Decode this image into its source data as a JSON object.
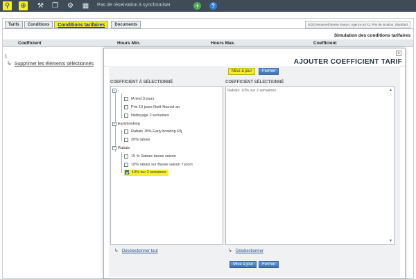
{
  "toolbar": {
    "icons": [
      "search-icon",
      "add-icon",
      "tools-icon",
      "copy-icon",
      "settings-icon",
      "calendar-icon"
    ],
    "status": "Pas de réservation à synchroniser",
    "green_button": "+",
    "help_button": "?"
  },
  "page": {
    "tabs": [
      "Tarifs",
      "Conditions",
      "Conditions tarifaires",
      "Documents"
    ],
    "tenant_info": "2022 [temporel] Basse Saison, Agence aXYZ, Prix de location, Standard",
    "simulation_title": "Simulation des conditions tarifaires",
    "table_headers": {
      "coefficient": "Coefficient",
      "hours_min": "Hours Min.",
      "hours_max": "Hours Max.",
      "coefficient2": "Coefficient"
    },
    "row_number": "1",
    "delete_selected": "Supprimer les éléments sélectionnés"
  },
  "modal": {
    "close": "x",
    "title": "AJOUTER COEFFICIENT TARIF",
    "update_label": "Mise à jour",
    "close_label": "Fermer",
    "dot": ".",
    "left_header": "COEFFICIENT À SÉLECTIONNÉ",
    "right_header": "COEFFICIENT SÉLECTIONNÉ",
    "tree": {
      "root": "-",
      "root_items": [
        "IA test 3 jours",
        "Prix 10 jours Noël-Nouvel-an",
        "Nettoyage 2 semaines"
      ],
      "group_earlybooking": "Earlybooking",
      "earlybooking_items": [
        "Rabais 15% Early booking 60j",
        "20% rabais"
      ],
      "group_rabais": "Rabais",
      "rabais_items": [
        "15 % Rabais basse saison",
        "10% rabais sur Basse saison 7 jours",
        "10% sur 2 semaines"
      ]
    },
    "selected_text": "Rabais: 10% sur 2 semaines",
    "deselect_all": "Désélectionner tout",
    "deselect": "Désélectionner"
  },
  "colors": {
    "highlight": "#f5ef2a",
    "toolbar_bg": "#3f4c57",
    "button_blue": "#3f73b5"
  }
}
